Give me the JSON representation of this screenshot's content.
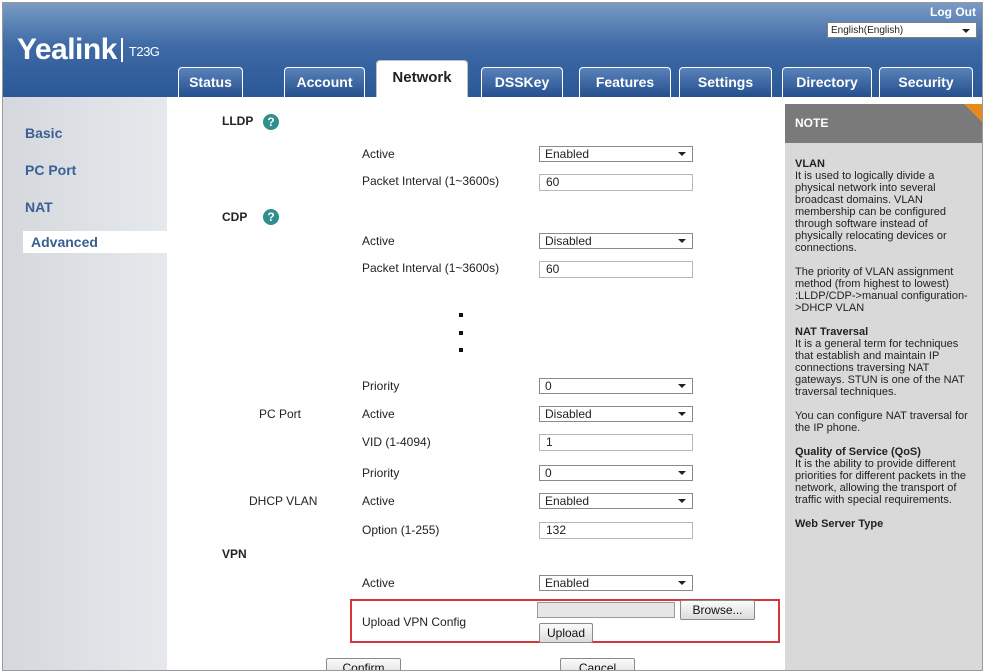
{
  "header": {
    "logo": "Yealink",
    "model": "T23G",
    "logout": "Log Out",
    "language": "English(English)",
    "tabs": [
      "Status",
      "Account",
      "Network",
      "DSSKey",
      "Features",
      "Settings",
      "Directory",
      "Security"
    ],
    "active_tab": "Network"
  },
  "sidebar": {
    "items": [
      "Basic",
      "PC Port",
      "NAT",
      "Advanced"
    ],
    "selected": "Advanced"
  },
  "content": {
    "lldp": {
      "title": "LLDP",
      "active_label": "Active",
      "active_value": "Enabled",
      "interval_label": "Packet Interval (1~3600s)",
      "interval_value": "60"
    },
    "cdp": {
      "title": "CDP",
      "active_label": "Active",
      "active_value": "Disabled",
      "interval_label": "Packet Interval (1~3600s)",
      "interval_value": "60"
    },
    "vlan": {
      "priority_label": "Priority",
      "priority_value": "0",
      "pc_port_label": "PC Port",
      "pc_active_label": "Active",
      "pc_active_value": "Disabled",
      "vid_label": "VID (1-4094)",
      "vid_value": "1",
      "pc_priority_label": "Priority",
      "pc_priority_value": "0",
      "dhcp_label": "DHCP VLAN",
      "dhcp_active_label": "Active",
      "dhcp_active_value": "Enabled",
      "option_label": "Option (1-255)",
      "option_value": "132"
    },
    "vpn": {
      "title": "VPN",
      "active_label": "Active",
      "active_value": "Enabled",
      "upload_label": "Upload VPN Config",
      "browse_label": "Browse...",
      "upload_button": "Upload"
    },
    "confirm_label": "Confirm",
    "cancel_label": "Cancel"
  },
  "note": {
    "title": "NOTE",
    "vlan_title": "VLAN",
    "vlan_text": "It is used to logically divide a physical network into several broadcast domains. VLAN membership can be configured through software instead of physically relocating devices or connections.",
    "vlan_priority_text": "The priority of VLAN assignment method (from highest to lowest) :LLDP/CDP->manual configuration->DHCP VLAN",
    "nat_title": "NAT Traversal",
    "nat_text": "It is a general term for techniques that establish and maintain IP connections traversing NAT gateways. STUN is one of the NAT traversal techniques.",
    "nat_config_text": "You can configure NAT traversal for the IP phone.",
    "qos_title": "Quality of Service (QoS)",
    "qos_text": "It is the ability to provide different priorities for different packets in the network, allowing the transport of traffic with special requirements.",
    "web_title": "Web Server Type"
  }
}
